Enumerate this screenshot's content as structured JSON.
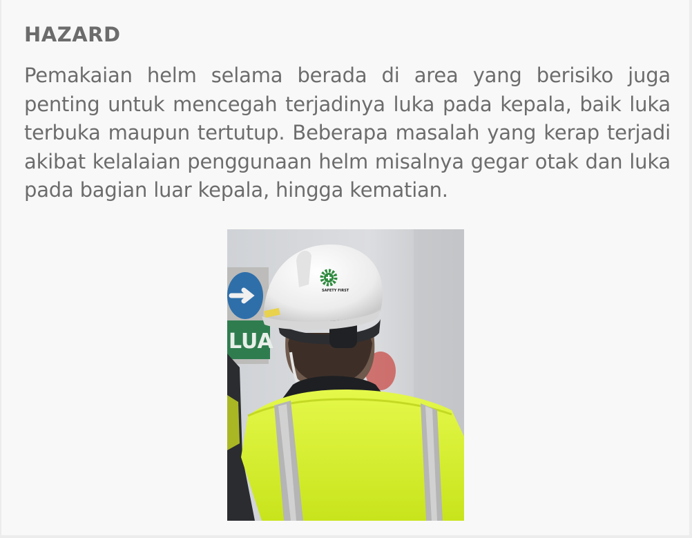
{
  "article": {
    "title": "HAZARD",
    "body": "Pemakaian helm selama berada di area yang berisiko juga penting untuk mencegah terjadinya luka pada kepala, baik luka terbuka maupun tertutup. Beberapa masalah yang kerap terjadi akibat kelalaian penggunaan helm misalnya gegar otak dan luka pada bagian luar kepala, hingga kematian."
  },
  "photo": {
    "helmet_logo_text": "SAFETY FIRST",
    "sign_text": "LUA",
    "colors": {
      "helmet": "#f4f4f4",
      "vest": "#d8f22a",
      "reflective_stripe": "#b5b5b5",
      "sign_blue": "#2e6faa",
      "sign_green": "#2f7d4f",
      "logo_green": "#2e8b3e"
    }
  }
}
